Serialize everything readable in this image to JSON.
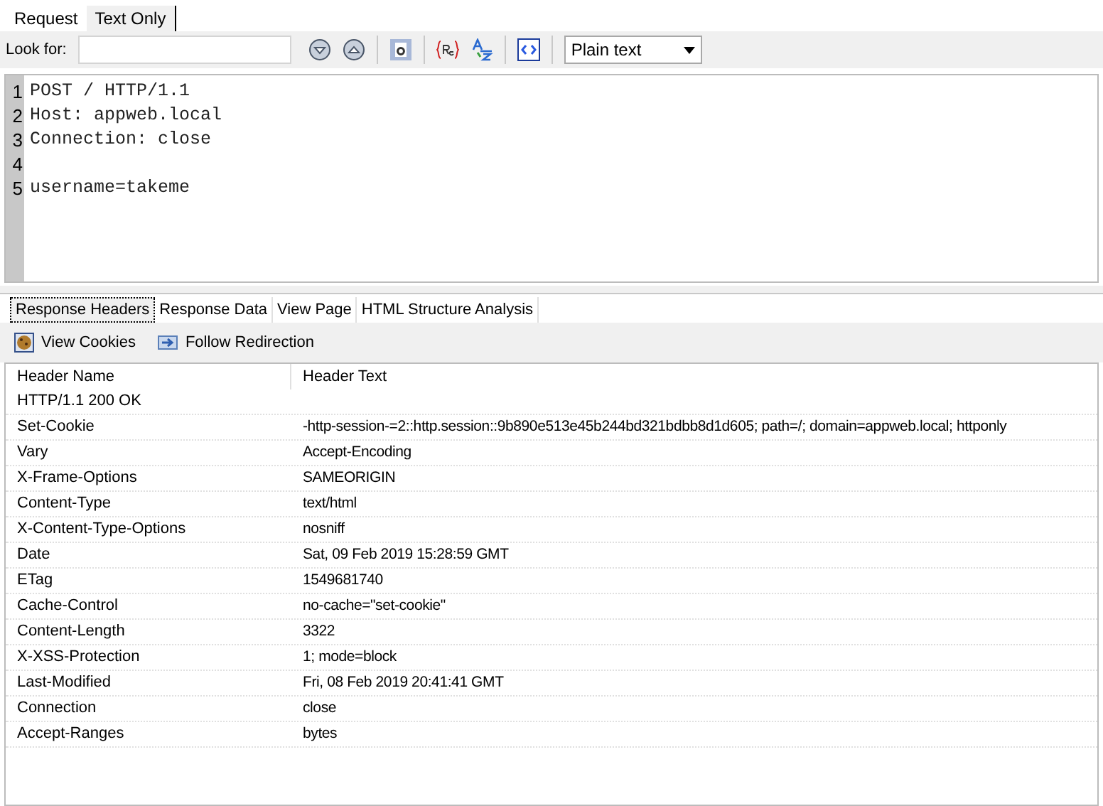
{
  "request_tabs": [
    {
      "label": "Request",
      "selected": false
    },
    {
      "label": "Text Only",
      "selected": true
    }
  ],
  "search": {
    "label": "Look for:"
  },
  "format_select": {
    "value": "Plain text"
  },
  "editor_lines": [
    {
      "number": "1",
      "text": "POST / HTTP/1.1"
    },
    {
      "number": "2",
      "text": "Host: appweb.local"
    },
    {
      "number": "3",
      "text": "Connection: close"
    },
    {
      "number": "4"
    },
    {
      "number": "5",
      "text": "username=takeme"
    }
  ],
  "response_tabs": [
    {
      "label": "Response Headers",
      "selected": true
    },
    {
      "label": "Response Data",
      "selected": false
    },
    {
      "label": "View Page",
      "selected": false
    },
    {
      "label": "HTML Structure Analysis",
      "selected": false
    }
  ],
  "actions": [
    {
      "kind": "cookies",
      "label": "View Cookies"
    },
    {
      "kind": "redirect",
      "label": "Follow Redirection"
    }
  ],
  "table": {
    "columns": [
      "Header Name",
      "Header Text"
    ],
    "rows": [
      [
        "HTTP/1.1 200 OK"
      ],
      [
        "Set-Cookie",
        "-http-session-=2::http.session::9b890e513e45b244bd321bdbb8d1d605; path=/; domain=appweb.local; httponly"
      ],
      [
        "Vary",
        "Accept-Encoding"
      ],
      [
        "X-Frame-Options",
        "SAMEORIGIN"
      ],
      [
        "Content-Type",
        "text/html"
      ],
      [
        "X-Content-Type-Options",
        "nosniff"
      ],
      [
        "Date",
        "Sat, 09 Feb 2019 15:28:59 GMT"
      ],
      [
        "ETag",
        "1549681740"
      ],
      [
        "Cache-Control",
        "no-cache=\"set-cookie\""
      ],
      [
        "Content-Length",
        "3322"
      ],
      [
        "X-XSS-Protection",
        "1; mode=block"
      ],
      [
        "Last-Modified",
        "Fri, 08 Feb 2019 20:41:41 GMT"
      ],
      [
        "Connection",
        "close"
      ],
      [
        "Accept-Ranges",
        "bytes"
      ]
    ]
  }
}
